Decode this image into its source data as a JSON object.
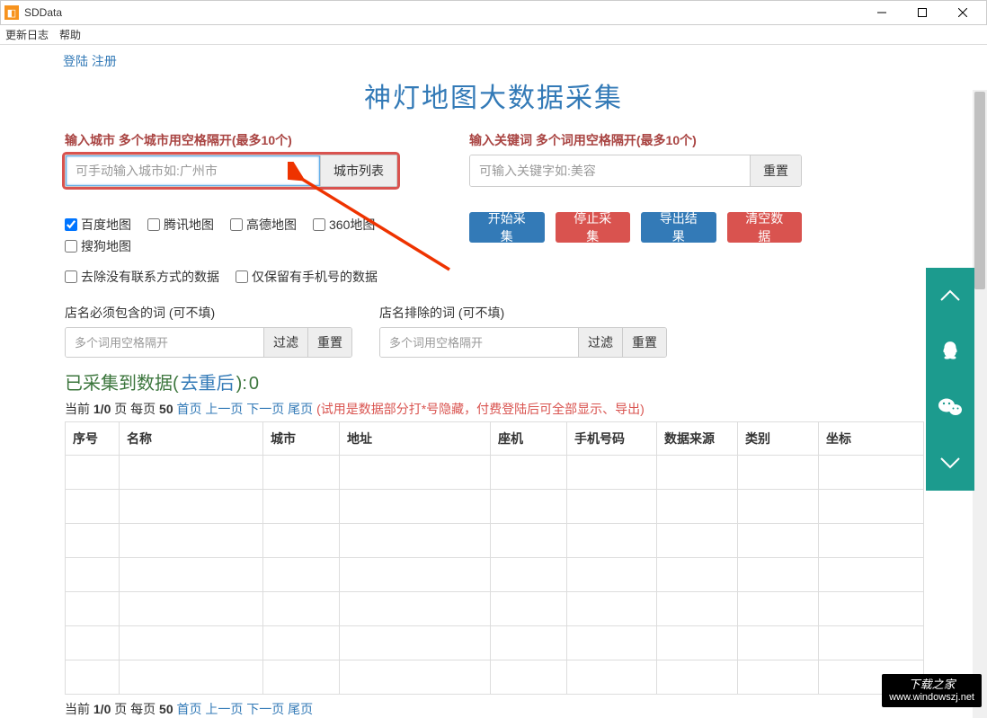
{
  "window": {
    "title": "SDData"
  },
  "menu": {
    "update_log": "更新日志",
    "help": "帮助"
  },
  "auth": {
    "login": "登陆",
    "register": "注册"
  },
  "header": {
    "title": "神灯地图大数据采集"
  },
  "city": {
    "label": "输入城市 多个城市用空格隔开(最多10个)",
    "placeholder": "可手动输入城市如:广州市",
    "list_btn": "城市列表"
  },
  "keyword": {
    "label": "输入关键词 多个词用空格隔开(最多10个)",
    "placeholder": "可输入关键字如:美容",
    "reset_btn": "重置"
  },
  "map_sources": {
    "baidu": "百度地图",
    "tencent": "腾讯地图",
    "gaode": "高德地图",
    "s360": "360地图",
    "sogou": "搜狗地图"
  },
  "actions": {
    "start": "开始采集",
    "stop": "停止采集",
    "export": "导出结果",
    "clear": "清空数据"
  },
  "data_filters": {
    "remove_no_contact": "去除没有联系方式的数据",
    "only_mobile": "仅保留有手机号的数据"
  },
  "name_include": {
    "label": "店名必须包含的词 (可不填)",
    "placeholder": "多个词用空格隔开",
    "filter_btn": "过滤",
    "reset_btn": "重置"
  },
  "name_exclude": {
    "label": "店名排除的词 (可不填)",
    "placeholder": "多个词用空格隔开",
    "filter_btn": "过滤",
    "reset_btn": "重置"
  },
  "collected": {
    "prefix": "已采集到数据(",
    "dedupe_link": "去重后",
    "suffix": "):",
    "count": "0"
  },
  "pager": {
    "text_prefix": "当前 ",
    "page": "1/0",
    "text_mid": " 页 每页 ",
    "per_page": "50",
    "first": "首页",
    "prev": "上一页",
    "next": "下一页",
    "last": "尾页",
    "hint": "(试用是数据部分打*号隐藏，付费登陆后可全部显示、导出)"
  },
  "table": {
    "headers": [
      "序号",
      "名称",
      "城市",
      "地址",
      "座机",
      "手机号码",
      "数据来源",
      "类别",
      "坐标"
    ]
  },
  "watermark": {
    "line1": "下载之家",
    "line2": "www.windowszj.net"
  }
}
